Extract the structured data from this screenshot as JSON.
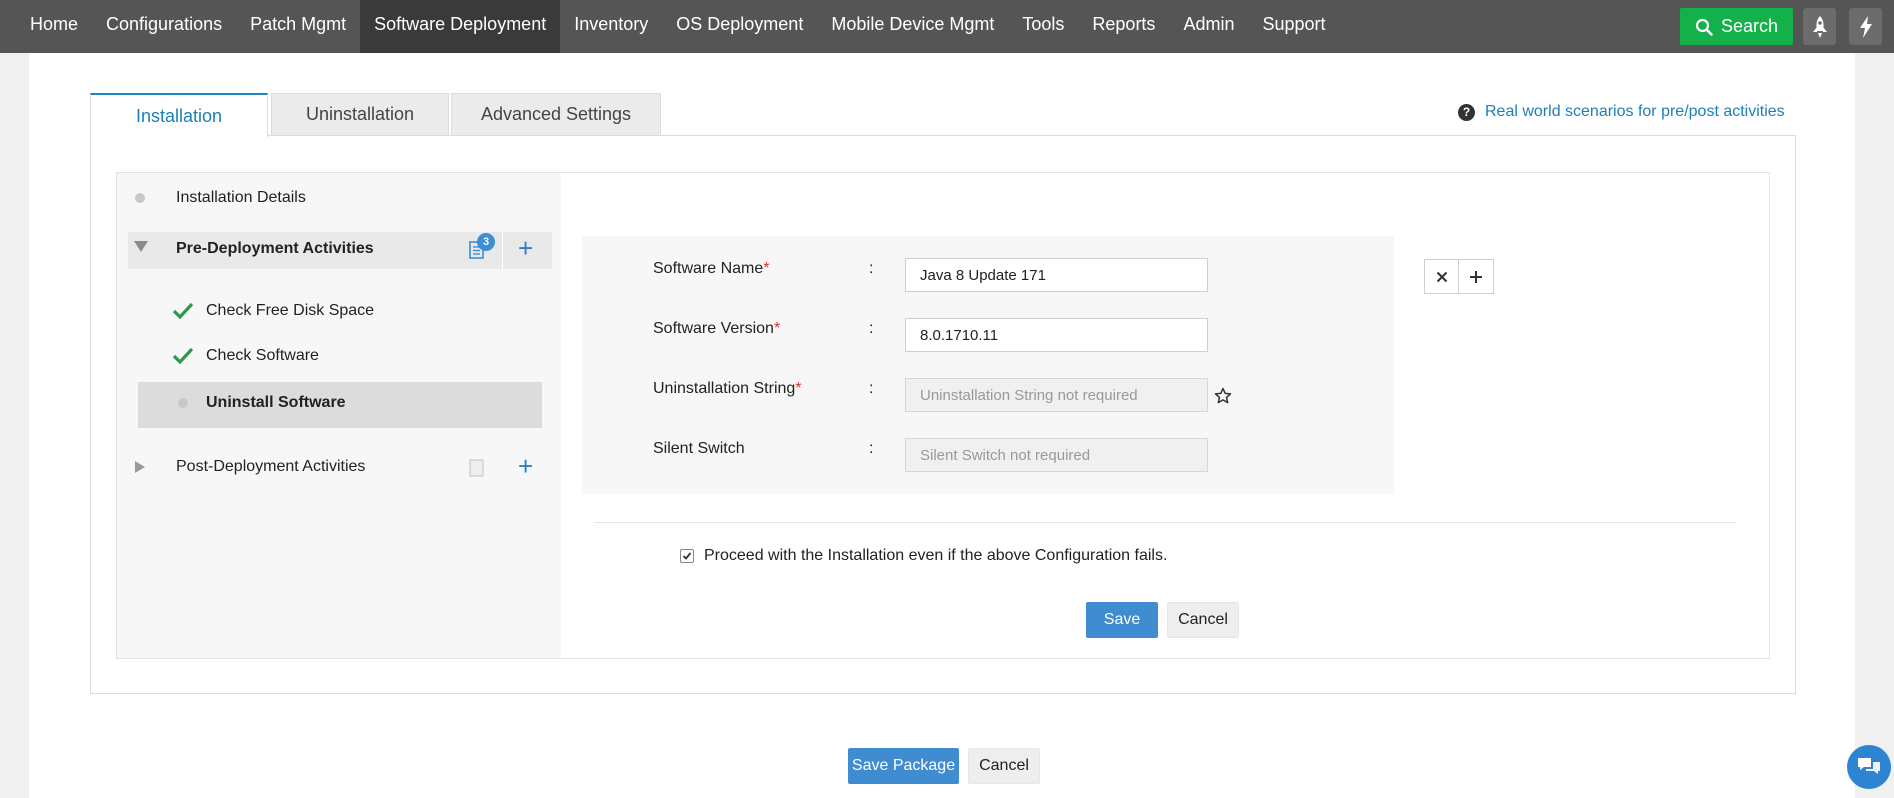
{
  "nav": {
    "items": [
      "Home",
      "Configurations",
      "Patch Mgmt",
      "Software Deployment",
      "Inventory",
      "OS Deployment",
      "Mobile Device Mgmt",
      "Tools",
      "Reports",
      "Admin",
      "Support"
    ],
    "active": "Software Deployment",
    "search_label": "Search"
  },
  "tabs": {
    "installation": "Installation",
    "uninstallation": "Uninstallation",
    "advanced": "Advanced Settings",
    "active": "Installation"
  },
  "help_link": "Real world scenarios for pre/post activities",
  "tree": {
    "installation_details": "Installation Details",
    "pre_deployment": "Pre-Deployment Activities",
    "pre_badge": "3",
    "pre_children": [
      {
        "label": "Check Free Disk Space",
        "status": "done"
      },
      {
        "label": "Check Software",
        "status": "done"
      },
      {
        "label": "Uninstall Software",
        "status": "selected"
      }
    ],
    "post_deployment": "Post-Deployment Activities"
  },
  "form": {
    "software_name_label": "Software Name",
    "software_name_value": "Java 8 Update 171",
    "software_version_label": "Software Version",
    "software_version_value": "8.0.1710.11",
    "uninstall_string_label": "Uninstallation String",
    "uninstall_string_placeholder": "Uninstallation String not required",
    "silent_switch_label": "Silent Switch",
    "silent_switch_placeholder": "Silent Switch not required",
    "required_mark": "*",
    "colon": ":",
    "proceed_label": "Proceed with the Installation even if the above Configuration fails.",
    "proceed_checked": true,
    "save": "Save",
    "cancel": "Cancel"
  },
  "footer": {
    "save_package": "Save Package",
    "cancel": "Cancel"
  },
  "colors": {
    "nav_bg": "#555555",
    "search_green": "#14b14b",
    "accent_blue": "#1c7fb8",
    "primary_button": "#3f8cd0",
    "check_green": "#2a9a4a"
  }
}
